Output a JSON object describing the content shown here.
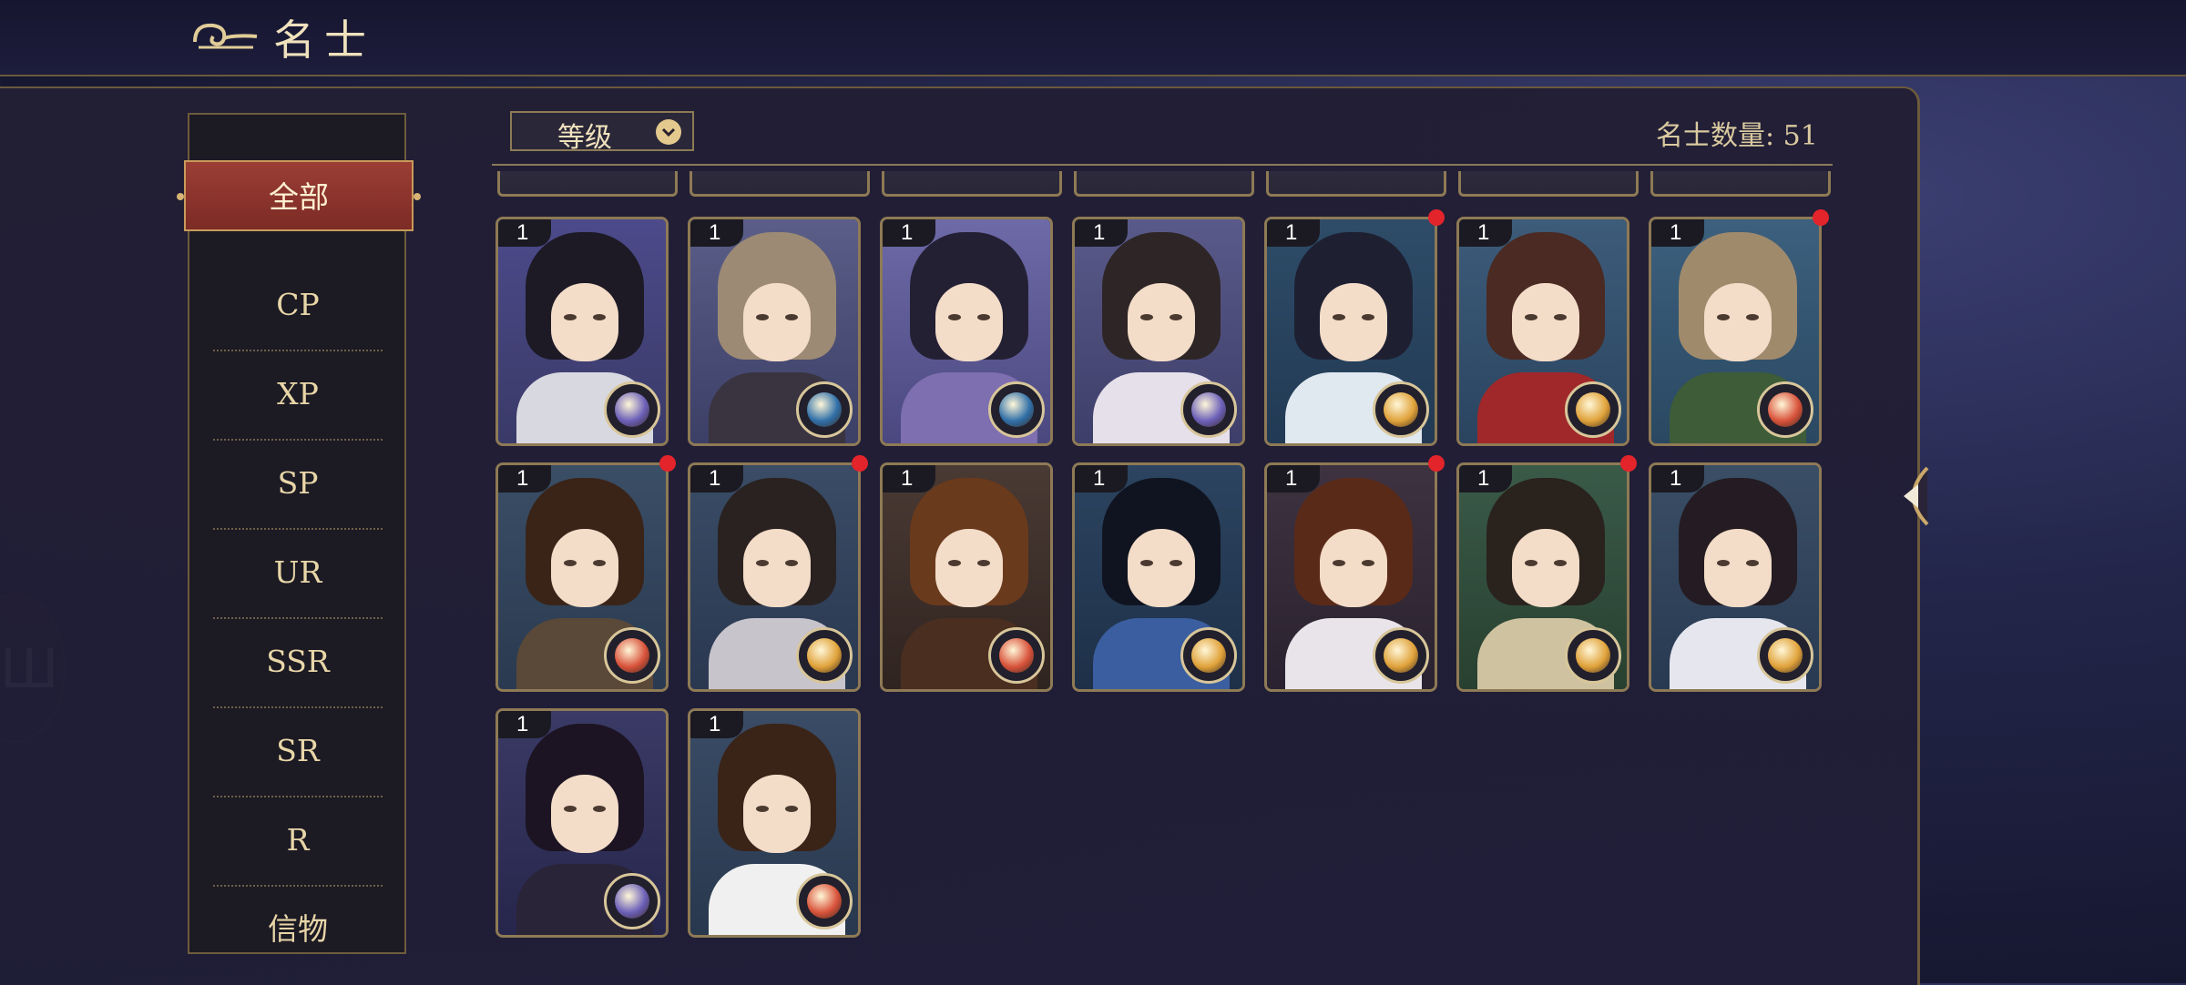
{
  "header": {
    "title": "名士"
  },
  "edge": {
    "glyph": "Ш"
  },
  "sidebar": {
    "items": [
      {
        "label": "全部",
        "active": true
      },
      {
        "label": "CP"
      },
      {
        "label": "XP"
      },
      {
        "label": "SP"
      },
      {
        "label": "UR"
      },
      {
        "label": "SSR"
      },
      {
        "label": "SR"
      },
      {
        "label": "R"
      },
      {
        "label": "信物"
      }
    ]
  },
  "toolbar": {
    "sort_label": "等级",
    "count_label": "名士数量: 51"
  },
  "colors": {
    "purple": "#6b5fb8",
    "blue": "#2f6fa8",
    "gold": "#e0a23a",
    "red": "#d8523a",
    "new_dot": "#e3242b"
  },
  "cards": [
    {
      "level": "1",
      "badge": "purple-orb-icon",
      "new": false
    },
    {
      "level": "1",
      "badge": "blue-eye-icon",
      "new": false
    },
    {
      "level": "1",
      "badge": "blue-eye-icon",
      "new": false
    },
    {
      "level": "1",
      "badge": "purple-orb-icon",
      "new": false
    },
    {
      "level": "1",
      "badge": "gold-orb-icon",
      "new": true
    },
    {
      "level": "1",
      "badge": "gold-orb-icon",
      "new": false
    },
    {
      "level": "1",
      "badge": "red-orb-icon",
      "new": true
    },
    {
      "level": "1",
      "badge": "red-orb-icon",
      "new": true
    },
    {
      "level": "1",
      "badge": "gold-orb-icon",
      "new": true
    },
    {
      "level": "1",
      "badge": "red-orb-icon",
      "new": false
    },
    {
      "level": "1",
      "badge": "gold-orb-icon",
      "new": false
    },
    {
      "level": "1",
      "badge": "gold-orb-icon",
      "new": true
    },
    {
      "level": "1",
      "badge": "gold-orb-icon",
      "new": true
    },
    {
      "level": "1",
      "badge": "gold-orb-icon",
      "new": false
    },
    {
      "level": "1",
      "badge": "purple-orb-icon",
      "new": false
    },
    {
      "level": "1",
      "badge": "red-orb-icon",
      "new": false
    }
  ]
}
